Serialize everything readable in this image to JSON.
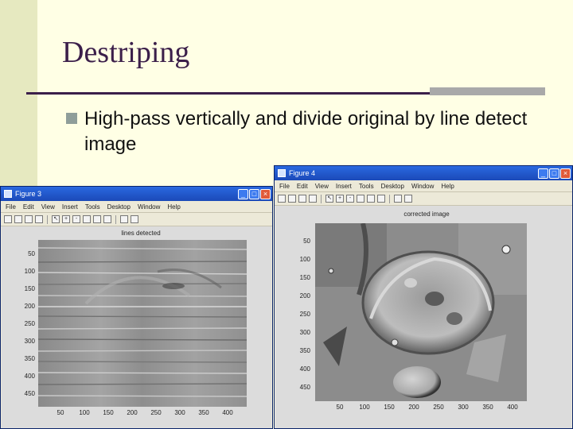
{
  "slide": {
    "title": "Destriping",
    "bullet": "High-pass vertically and divide original by line detect image"
  },
  "figure3": {
    "window_title": "Figure 3",
    "menu": [
      "File",
      "Edit",
      "View",
      "Insert",
      "Tools",
      "Desktop",
      "Window",
      "Help"
    ],
    "plot_title": "lines detected",
    "yticks": [
      "50",
      "100",
      "150",
      "200",
      "250",
      "300",
      "350",
      "400",
      "450"
    ],
    "xticks": [
      "50",
      "100",
      "150",
      "200",
      "250",
      "300",
      "350",
      "400"
    ]
  },
  "figure4": {
    "window_title": "Figure 4",
    "menu": [
      "File",
      "Edit",
      "View",
      "Insert",
      "Tools",
      "Desktop",
      "Window",
      "Help"
    ],
    "plot_title": "corrected image",
    "yticks": [
      "50",
      "100",
      "150",
      "200",
      "250",
      "300",
      "350",
      "400",
      "450"
    ],
    "xticks": [
      "50",
      "100",
      "150",
      "200",
      "250",
      "300",
      "350",
      "400"
    ]
  },
  "colors": {
    "title": "#3b1f4a",
    "leftbar": "#e6e9c0",
    "background": "#ffffe5"
  }
}
